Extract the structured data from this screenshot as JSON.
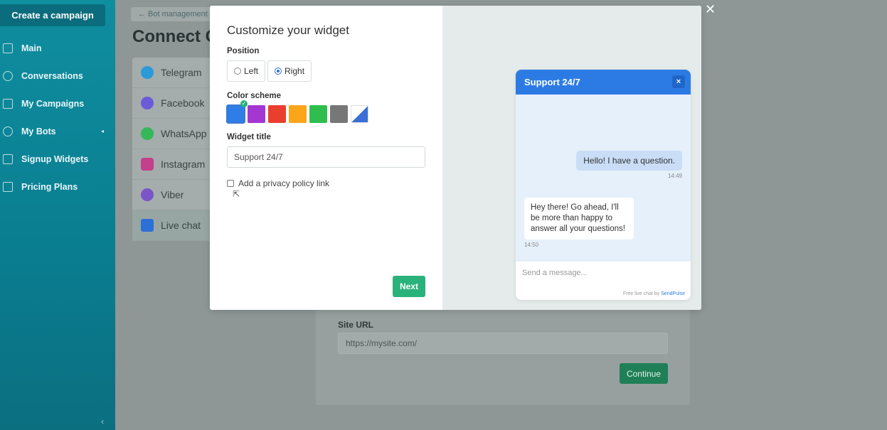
{
  "sidebar": {
    "create_label": "Create a campaign",
    "items": [
      {
        "label": "Main",
        "icon": "grid-icon"
      },
      {
        "label": "Conversations",
        "icon": "chat-icon"
      },
      {
        "label": "My Campaigns",
        "icon": "campaign-icon"
      },
      {
        "label": "My Bots",
        "icon": "bot-icon"
      },
      {
        "label": "Signup Widgets",
        "icon": "widget-icon"
      },
      {
        "label": "Pricing Plans",
        "icon": "pricing-icon"
      }
    ],
    "caret": "◂",
    "collapse": "‹"
  },
  "background": {
    "crumb": "← Bot management",
    "title": "Connect C",
    "channels": [
      {
        "label": "Telegram",
        "color": "#2a9ad8"
      },
      {
        "label": "Facebook",
        "color": "#6b5bd8"
      },
      {
        "label": "WhatsApp",
        "color": "#34b85a"
      },
      {
        "label": "Instagram",
        "color": "#c4408a"
      },
      {
        "label": "Viber",
        "color": "#7a55c8"
      },
      {
        "label": "Live chat",
        "color": "#2c6fd6"
      }
    ],
    "site_label": "Site URL",
    "site_value": "https://mysite.com/",
    "continue_label": "Continue"
  },
  "modal": {
    "title": "Customize your widget",
    "position_label": "Position",
    "left_label": "Left",
    "right_label": "Right",
    "selected_position": "Right",
    "color_label": "Color scheme",
    "colors": [
      "#2f7de6",
      "#a436d3",
      "#ea3f2f",
      "#fba51a",
      "#2fbe4d",
      "#777777"
    ],
    "widget_title_label": "Widget title",
    "widget_title_value": "Support 24/7",
    "privacy_label": "Add a privacy policy link",
    "next_label": "Next",
    "close": "✕"
  },
  "widget": {
    "title": "Support 24/7",
    "close": "×",
    "msg_out": "Hello! I have a question.",
    "time_out": "14:49",
    "msg_in": "Hey there! Go ahead, I'll be more than happy to answer all your questions!",
    "time_in": "14:50",
    "placeholder": "Send a message...",
    "footer_prefix": "Free live chat by ",
    "footer_brand": "SendPulse"
  }
}
